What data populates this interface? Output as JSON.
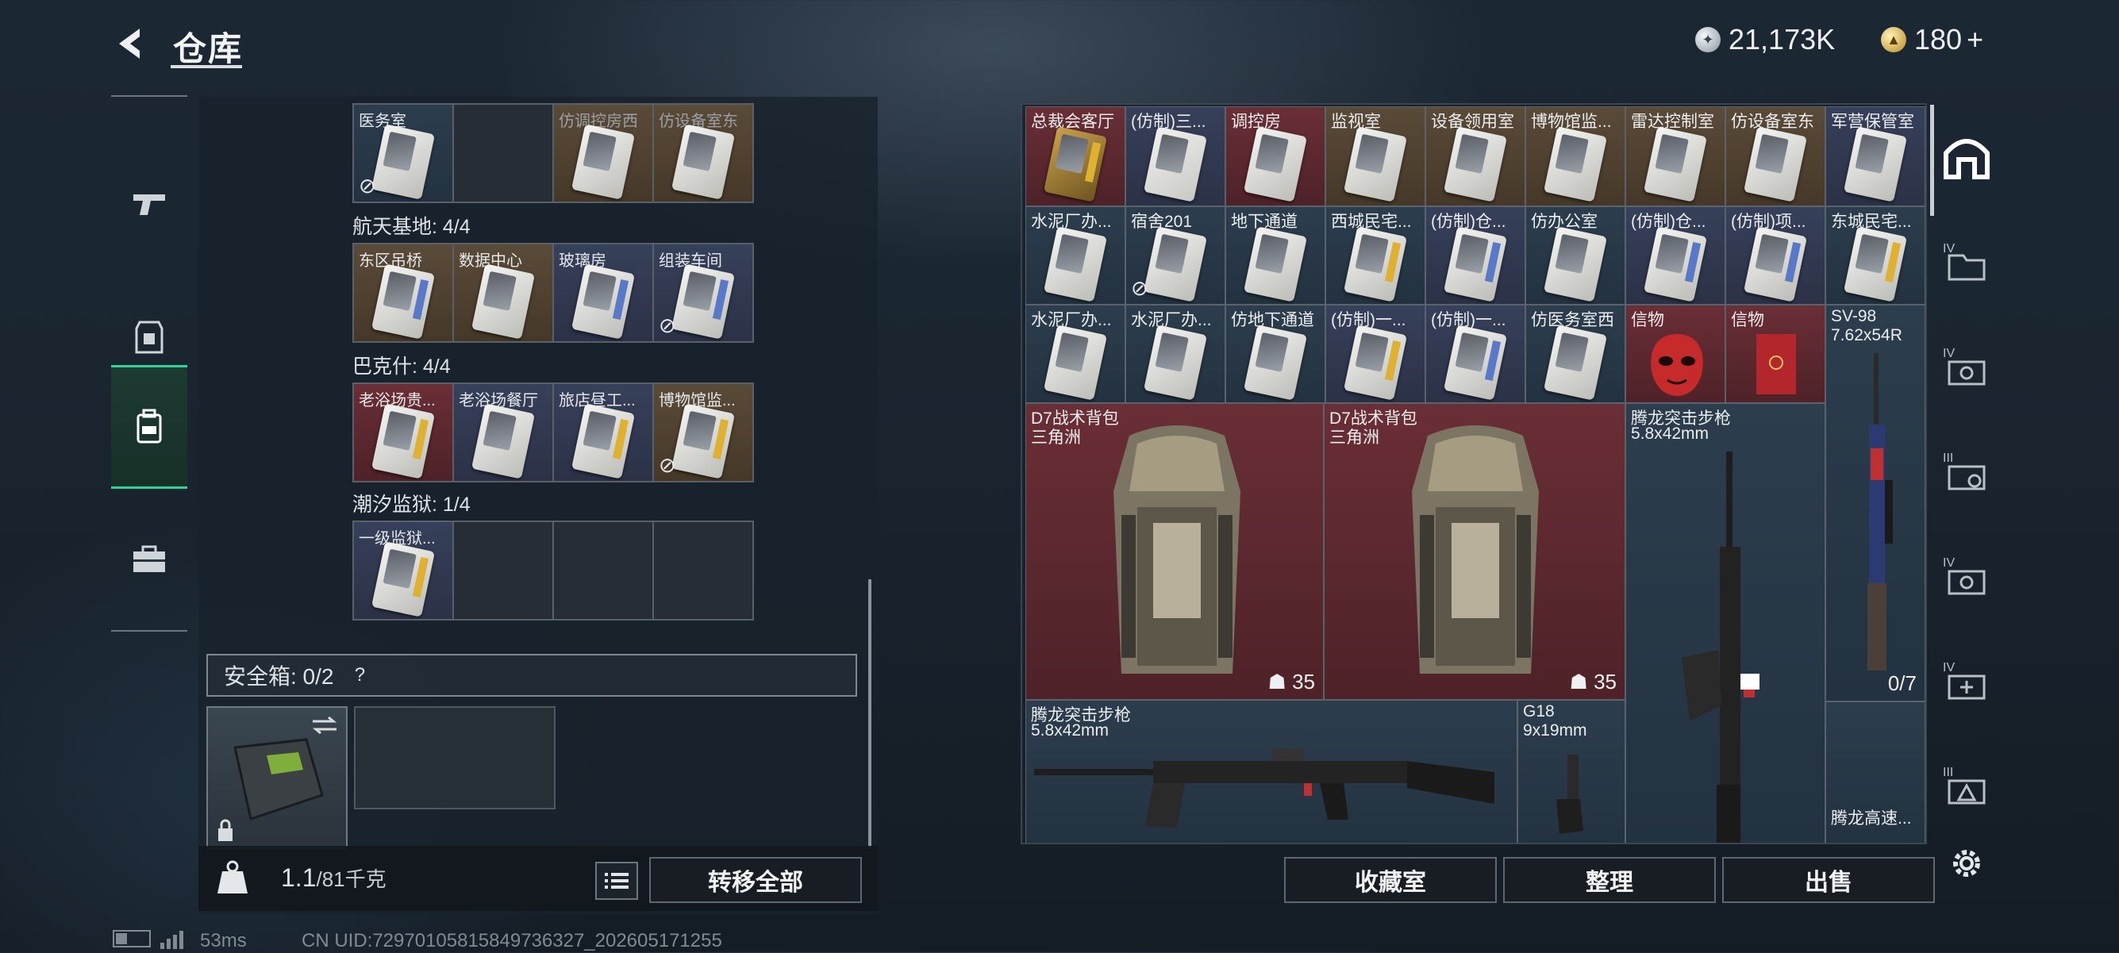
{
  "header": {
    "title": "仓库",
    "silver_amount": "21,173K",
    "gold_amount": "180",
    "gold_plus": "+"
  },
  "left_nav": {
    "items": [
      {
        "name": "weapon-icon"
      },
      {
        "name": "armor-icon"
      },
      {
        "name": "backpack-icon",
        "active": true
      },
      {
        "name": "toolbox-icon"
      }
    ]
  },
  "left_panel": {
    "top_row": [
      "医务室",
      "",
      "仿调控房西",
      "仿设备室东"
    ],
    "sections": [
      {
        "title": "航天基地: 4/4",
        "cells": [
          "东区吊桥",
          "数据中心",
          "玻璃房",
          "组装车间"
        ]
      },
      {
        "title": "巴克什: 4/4",
        "cells": [
          "老浴场贵...",
          "老浴场餐厅",
          "旅店昼工...",
          "博物馆监..."
        ]
      },
      {
        "title": "潮汐监狱: 1/4",
        "cells": [
          "一级监狱...",
          "",
          "",
          ""
        ]
      }
    ],
    "safe_box_label": "安全箱: 0/2",
    "help_symbol": "?",
    "weight_value": "1.1",
    "weight_capacity": "/81千克",
    "transfer_all_label": "转移全部"
  },
  "right_panel": {
    "row1": [
      "总裁会客厅",
      "(仿制)三...",
      "调控房",
      "监视室",
      "设备领用室",
      "博物馆监...",
      "雷达控制室",
      "仿设备室东",
      "军营保管室"
    ],
    "row2": [
      "水泥厂办...",
      "宿舍201",
      "地下通道",
      "西城民宅...",
      "(仿制)仓...",
      "仿办公室",
      "(仿制)仓...",
      "(仿制)项...",
      "东城民宅..."
    ],
    "row3": [
      "水泥厂办...",
      "水泥厂办...",
      "仿地下通道",
      "(仿制)一...",
      "(仿制)一...",
      "仿医务室西",
      "信物",
      "信物"
    ],
    "sv98": {
      "name": "SV-98",
      "ammo": "7.62x54R",
      "count": "0/7"
    },
    "backpack1": {
      "name": "D7战术背包",
      "sub": "三角洲",
      "count": "35"
    },
    "backpack2": {
      "name": "D7战术背包",
      "sub": "三角洲",
      "count": "35"
    },
    "rifle_vertical": {
      "name": "腾龙突击步枪",
      "ammo": "5.8x42mm"
    },
    "rifle_horizontal": {
      "name": "腾龙突击步枪",
      "ammo": "5.8x42mm"
    },
    "pistol": {
      "name": "G18",
      "ammo": "9x19mm"
    },
    "partial_item": "腾龙高速...",
    "collection_label": "收藏室",
    "sort_label": "整理",
    "sell_label": "出售"
  },
  "footer": {
    "ping": "53ms",
    "uid": "CN UID:7297010581584973632​7_202605171255"
  }
}
